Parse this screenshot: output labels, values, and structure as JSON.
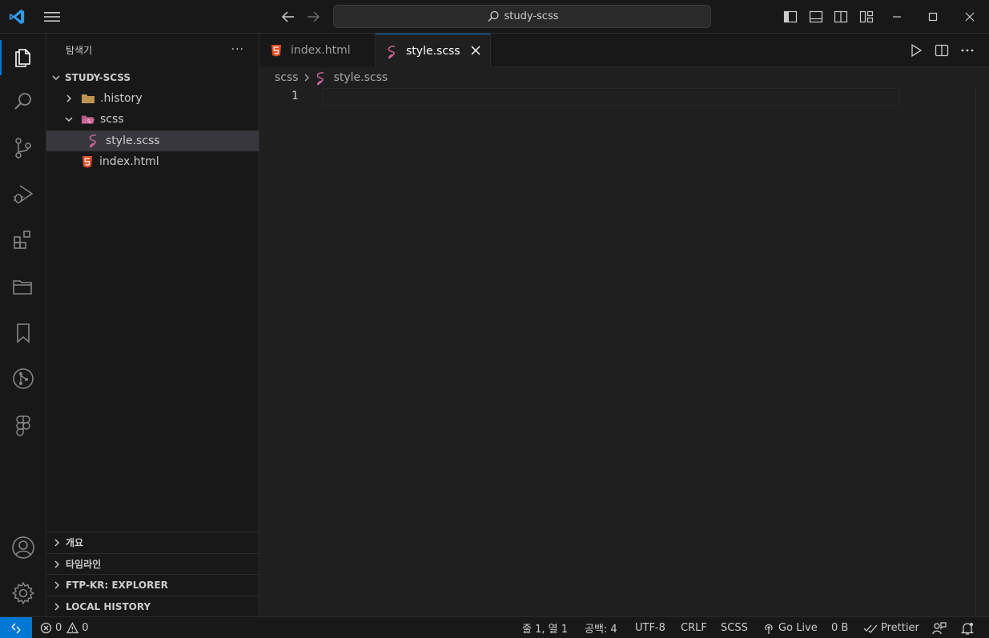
{
  "window": {
    "search_text": "study-scss"
  },
  "sidebar": {
    "title": "탐색기",
    "more": "···",
    "root": "STUDY-SCSS",
    "tree": [
      {
        "label": ".history",
        "type": "folder"
      },
      {
        "label": "scss",
        "type": "folder-open"
      },
      {
        "label": "style.scss",
        "type": "scss-file"
      },
      {
        "label": "index.html",
        "type": "html-file"
      }
    ],
    "sections": [
      "개요",
      "타임라인",
      "FTP-KR: EXPLORER",
      "LOCAL HISTORY"
    ]
  },
  "tabs": [
    {
      "label": "index.html",
      "active": false
    },
    {
      "label": "style.scss",
      "active": true
    }
  ],
  "breadcrumb": [
    "scss",
    "style.scss"
  ],
  "editor": {
    "line_numbers": [
      "1"
    ]
  },
  "status": {
    "errors": "0",
    "warnings": "0",
    "position": "줄 1, 열 1",
    "indent": "공백: 4",
    "encoding": "UTF-8",
    "eol": "CRLF",
    "language": "SCSS",
    "golive": "Go Live",
    "size": "0 B",
    "prettier": "Prettier"
  },
  "colors": {
    "accent": "#0078d4",
    "scss": "#cd6799",
    "html": "#e44d26",
    "folder": "#c09553"
  }
}
